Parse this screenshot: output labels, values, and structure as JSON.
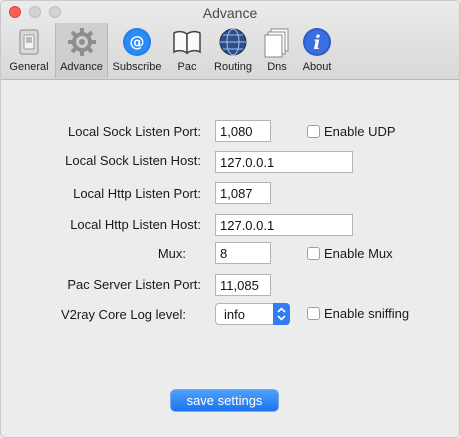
{
  "window": {
    "title": "Advance"
  },
  "toolbar": {
    "tabs": [
      {
        "label": "General",
        "icon": "switch-icon"
      },
      {
        "label": "Advance",
        "icon": "gear-icon"
      },
      {
        "label": "Subscribe",
        "icon": "at-sign-icon"
      },
      {
        "label": "Pac",
        "icon": "book-icon"
      },
      {
        "label": "Routing",
        "icon": "globe-icon"
      },
      {
        "label": "Dns",
        "icon": "documents-icon"
      },
      {
        "label": "About",
        "icon": "info-icon"
      }
    ],
    "active_tab": "Advance"
  },
  "form": {
    "sock_port_label": "Local Sock Listen Port:",
    "sock_port_value": "1,080",
    "enable_udp_label": "Enable UDP",
    "enable_udp_checked": false,
    "sock_host_label": "Local Sock Listen Host:",
    "sock_host_value": "127.0.0.1",
    "http_port_label": "Local Http Listen Port:",
    "http_port_value": "1,087",
    "http_host_label": "Local Http Listen Host:",
    "http_host_value": "127.0.0.1",
    "mux_label": "Mux:",
    "mux_value": "8",
    "enable_mux_label": "Enable Mux",
    "enable_mux_checked": false,
    "pac_port_label": "Pac Server Listen Port:",
    "pac_port_value": "11,085",
    "log_level_label": "V2ray Core Log level:",
    "log_level_value": "info",
    "enable_sniffing_label": "Enable sniffing",
    "enable_sniffing_checked": false
  },
  "actions": {
    "save_label": "save settings"
  },
  "colors": {
    "accent": "#2f7cf6",
    "close": "#fc5f57"
  }
}
